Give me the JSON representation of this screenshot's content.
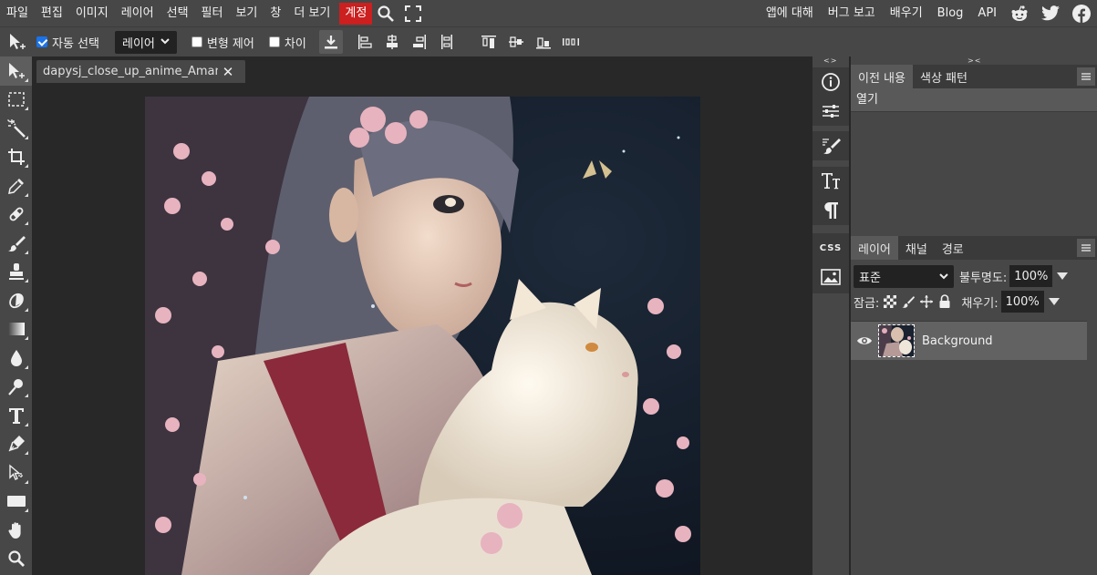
{
  "menubar": {
    "items": [
      "파일",
      "편집",
      "이미지",
      "레이어",
      "선택",
      "필터",
      "보기",
      "창",
      "더 보기"
    ],
    "highlight_item": "계정",
    "right_items": [
      "앱에 대해",
      "버그 보고",
      "배우기",
      "Blog",
      "API"
    ],
    "social_icons": [
      "reddit-icon",
      "twitter-icon",
      "facebook-icon"
    ]
  },
  "options": {
    "auto_select_label": "자동 선택",
    "auto_select_checked": true,
    "target_value": "레이어",
    "transform_label": "변형 제어",
    "distance_label": "차이"
  },
  "document": {
    "tab_title": "dapysj_close_up_anime_Amano",
    "close_glyph": "✕"
  },
  "history_panel": {
    "tabs": [
      "이전 내용",
      "색상 패턴"
    ],
    "items": [
      "열기"
    ]
  },
  "layers_panel": {
    "tabs": [
      "레이어",
      "채널",
      "경로"
    ],
    "blend_mode": "표준",
    "opacity_label": "불투명도:",
    "opacity_value": "100%",
    "lock_label": "잠금:",
    "fill_label": "채우기:",
    "fill_value": "100%",
    "layers": [
      {
        "name": "Background",
        "visible": true
      }
    ]
  },
  "strip": {
    "css_label": "CSS",
    "arrows_top": "<>",
    "arrows_right": "><"
  },
  "colors": {
    "accent_red": "#cc1f1f",
    "panel_bg": "#474747",
    "workspace_bg": "#282828",
    "checkbox_blue": "#1a73e8"
  }
}
